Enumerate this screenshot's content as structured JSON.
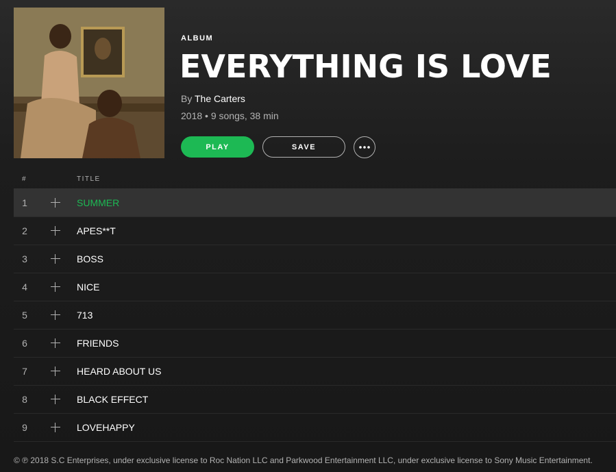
{
  "album": {
    "type_label": "ALBUM",
    "title": "EVERYTHING IS LOVE",
    "by_prefix": "By",
    "artist": "The Carters",
    "meta": "2018 • 9 songs, 38 min"
  },
  "actions": {
    "play_label": "PLAY",
    "save_label": "SAVE",
    "more_icon": "more-horizontal-icon"
  },
  "tracklist": {
    "header_num": "#",
    "header_title": "TITLE",
    "tracks": [
      {
        "num": "1",
        "title": "SUMMER",
        "active": true
      },
      {
        "num": "2",
        "title": "APES**T"
      },
      {
        "num": "3",
        "title": "BOSS"
      },
      {
        "num": "4",
        "title": "NICE"
      },
      {
        "num": "5",
        "title": "713"
      },
      {
        "num": "6",
        "title": "FRIENDS"
      },
      {
        "num": "7",
        "title": "HEARD ABOUT US"
      },
      {
        "num": "8",
        "title": "BLACK EFFECT"
      },
      {
        "num": "9",
        "title": "LOVEHAPPY"
      }
    ]
  },
  "copyright": "© ℗ 2018 S.C Enterprises, under exclusive license to Roc Nation LLC and Parkwood Entertainment LLC, under exclusive license to Sony Music Entertainment.",
  "colors": {
    "accent": "#1db954",
    "background": "#181818",
    "active_row": "#333333"
  }
}
